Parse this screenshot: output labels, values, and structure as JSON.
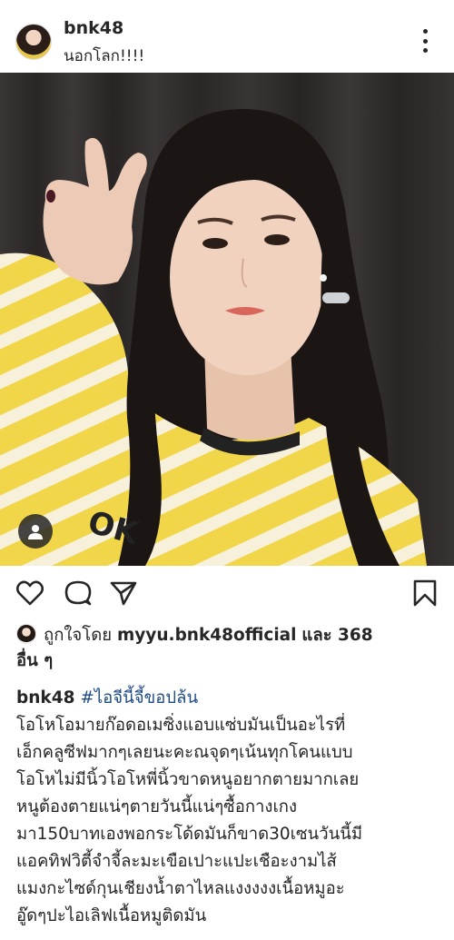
{
  "post": {
    "username": "bnk48",
    "location": "นอกโลก!!!!"
  },
  "icons": {
    "more": "more-vertical-icon",
    "like": "heart-icon",
    "comment": "comment-icon",
    "share": "send-icon",
    "save": "bookmark-icon",
    "tag": "user-tag-icon"
  },
  "likes": {
    "prefix": "ถูกใจโดย",
    "user": "myyu.bnk48official",
    "suffix": "และ 368",
    "suffix2": "อื่น ๆ"
  },
  "caption": {
    "username": "bnk48",
    "hashtag": "#ไอจีนี้จี้ขอปล้น",
    "lines": [
      "โอโหโอมายก๊อดอเมซิ่งแอบแซ่บมันเป็นอะไรที่",
      "เอ็กคลูซีฟมากๆเลยนะคะณจุดๆเน้นทุกโคนแบบ",
      "โอโหไม่มีนิ้วโอโหพี่นิ้วขาดหนูอยากตายมากเลย",
      "หนูต้องตายแน่ๆตายวันนี้แน่ๆซื้อกางเกง",
      "มา150บาทเองพอกระโด้ดมันก็ขาด30เซนวันนี้มี",
      "แอคทิฟวิตี้จำจี้ละมะเขือเปาะแปะเชือะงามไส้",
      "แมงกะไซด์กุนเชียงน้ำตาไหลแงงงงงเนื้อหมูอะ",
      "อู๊ดๆปะไอเลิฟเนื้อหมูติดมัน"
    ]
  }
}
